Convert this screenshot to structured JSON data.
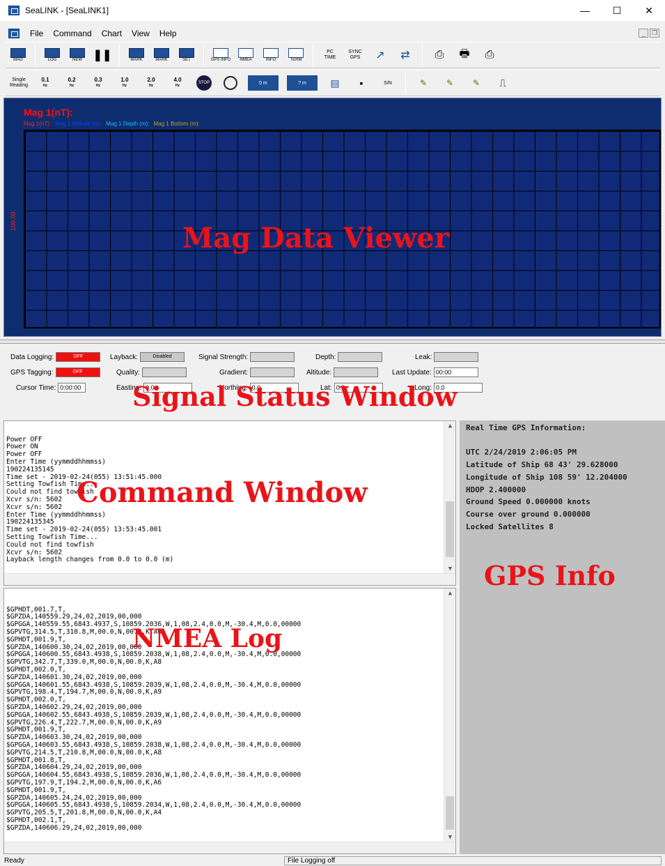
{
  "window": {
    "title": "SeaLINK - [SeaLINK1]",
    "minimize": "—",
    "maximize": "☐",
    "close": "✕"
  },
  "menu": [
    "File",
    "Command",
    "Chart",
    "View",
    "Help"
  ],
  "toolbar1": [
    {
      "icon": "mag-icon",
      "label": "MAG"
    },
    {
      "icon": "log-icon",
      "label": "LOG"
    },
    {
      "icon": "new-icon",
      "label": "NEW"
    },
    {
      "icon": "pause-icon",
      "label": ""
    },
    {
      "icon": "mark-icon",
      "label": "MARK"
    },
    {
      "icon": "mark2-icon",
      "label": "MARK"
    },
    {
      "icon": "set-icon",
      "label": "SET"
    },
    {
      "icon": "gps-info-icon",
      "label": "GPS INFO"
    },
    {
      "icon": "nmea-icon",
      "label": "NMEA"
    },
    {
      "icon": "info-icon",
      "label": "INFO"
    },
    {
      "icon": "term-icon",
      "label": "TERM"
    },
    {
      "icon": "pc-time-icon",
      "label": "PC TIME"
    },
    {
      "icon": "sync-gps-icon",
      "label": "SYNC GPS"
    }
  ],
  "toolbar2": {
    "single_reading": "Single Reading",
    "rates": [
      {
        "value": "0.1",
        "unit": "Hz"
      },
      {
        "value": "0.2",
        "unit": "Hz"
      },
      {
        "value": "0.3",
        "unit": "Hz"
      },
      {
        "value": "1.0",
        "unit": "Hz"
      },
      {
        "value": "2.0",
        "unit": "Hz"
      },
      {
        "value": "4.0",
        "unit": "Hz"
      }
    ],
    "stop": "STOP",
    "depth_0": "0 m",
    "depth_q": "? m",
    "sn": "S/N"
  },
  "mag": {
    "title": "Mag 1(nT):",
    "legend": [
      {
        "text": "Mag 1(nT):",
        "color": "#ff2020"
      },
      {
        "text": "Mag 1 Altitude (m):",
        "color": "#1040ff"
      },
      {
        "text": "Mag 1 Depth (m):",
        "color": "#10c0ff"
      },
      {
        "text": "Mag 1 Bottom (m):",
        "color": "#c0a020"
      }
    ],
    "y_label": "100.00",
    "overlay": "Mag Data Viewer"
  },
  "status": {
    "data_logging": {
      "label": "Data Logging:",
      "value": "OFF"
    },
    "gps_tagging": {
      "label": "GPS Tagging:",
      "value": "OFF"
    },
    "cursor_time": {
      "label": "Cursor Time:",
      "value": "0:00:00"
    },
    "layback": {
      "label": "Layback:",
      "value": "Disabled"
    },
    "quality": {
      "label": "Quality:"
    },
    "easting": {
      "label": "Easting:",
      "value": "0.0"
    },
    "signal_strength": {
      "label": "Signal Strength:"
    },
    "gradient": {
      "label": "Gradient:"
    },
    "northing": {
      "label": "Northing:",
      "value": "0.0"
    },
    "depth": {
      "label": "Depth:"
    },
    "altitude": {
      "label": "Altitude:"
    },
    "lat": {
      "label": "Lat:",
      "value": "0.0"
    },
    "leak": {
      "label": "Leak:"
    },
    "last_update": {
      "label": "Last Update:",
      "value": "00:00"
    },
    "long": {
      "label": "Long:",
      "value": "0.0"
    },
    "overlay": "Signal Status Window"
  },
  "command_window": {
    "lines": "Power OFF\nPower ON\nPower OFF\nEnter Time (yymmddhhmmss)\n190224135145\nTime set - 2019-02-24(055) 13:51:45.000\nSetting Towfish Time...\nCould not find towfish\nXcvr s/n: 5602\nXcvr s/n: 5602\nEnter Time (yymmddhhmmss)\n190224135345\nTime set - 2019-02-24(055) 13:53:45.001\nSetting Towfish Time...\nCould not find towfish\nXcvr s/n: 5602\nLayback length changes from 0.0 to 0.0 (m)",
    "overlay": "Command Window"
  },
  "nmea_log": {
    "lines": "$GPHDT,001.7,T,\n$GPZDA,140559.29,24,02,2019,00,000\n$GPGGA,140559.55,6843.4937,S,10859.2036,W,1,08,2.4,0.0,M,-30.4,M,0.0,00000\n$GPVTG,314.5,T,310.8,M,00.0,N,00.0,K,A6\n$GPHDT,001.9,T,\n$GPZDA,140600.30,24,02,2019,00,000\n$GPGGA,140600.55,6843.4938,S,10859.2038,W,1,08,2.4,0.0,M,-30.4,M,0.0,00000\n$GPVTG,342.7,T,339.0,M,00.0,N,00.0,K,A8\n$GPHDT,002.0,T,\n$GPZDA,140601.30,24,02,2019,00,000\n$GPGGA,140601.55,6843.4938,S,10859.2039,W,1,08,2.4,0.0,M,-30.4,M,0.0,00000\n$GPVTG,198.4,T,194.7,M,00.0,N,00.0,K,A9\n$GPHDT,002.0,T,\n$GPZDA,140602.29,24,02,2019,00,000\n$GPGGA,140602.55,6843.4938,S,10859.2039,W,1,08,2.4,0.0,M,-30.4,M,0.0,00000\n$GPVTG,226.4,T,222.7,M,00.0,N,00.0,K,A9\n$GPHDT,001.9,T,\n$GPZDA,140603.30,24,02,2019,00,000\n$GPGGA,140603.55,6843.4938,S,10859.2038,W,1,08,2.4,0.0,M,-30.4,M,0.0,00000\n$GPVTG,214.5,T,210.8,M,00.0,N,00.0,K,A8\n$GPHDT,001.8,T,\n$GPZDA,140604.29,24,02,2019,00,000\n$GPGGA,140604.55,6843.4938,S,10859.2036,W,1,08,2.4,0.0,M,-30.4,M,0.0,00000\n$GPVTG,197.9,T,194.2,M,00.0,N,00.0,K,A6\n$GPHDT,001.9,T,\n$GPZDA,140605.24,24,02,2019,00,000\n$GPGGA,140605.55,6843.4938,S,10859.2034,W,1,08,2.4,0.0,M,-30.4,M,0.0,00000\n$GPVTG,205.5,T,201.8,M,00.0,N,00.0,K,A4\n$GPHDT,002.1,T,\n$GPZDA,140606.29,24,02,2019,00,000",
    "overlay": "NMEA Log"
  },
  "gps_info": {
    "lines": "Real Time GPS Information:\n\nUTC 2/24/2019 2:06:05 PM\nLatitude of Ship 68 43' 29.628000\nLongitude of Ship 108 59' 12.204000\nHDOP 2.400000\nGround Speed 0.000000 knots\nCourse over ground 0.000000\nLocked Satellites 8",
    "overlay": "GPS Info"
  },
  "statusbar": {
    "left": "Ready",
    "right": "File Logging off"
  }
}
